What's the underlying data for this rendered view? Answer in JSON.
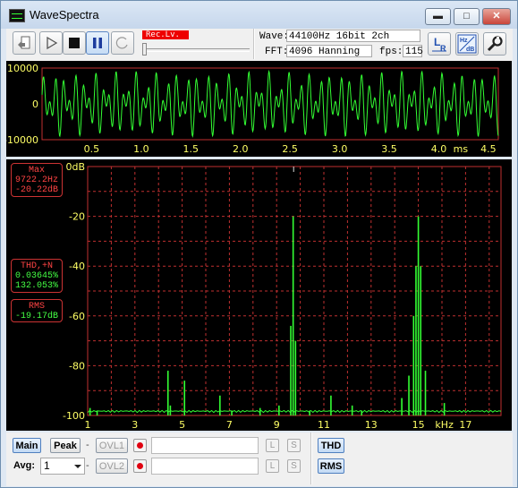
{
  "window": {
    "title": "WaveSpectra",
    "minimize": "▬",
    "maximize": "□",
    "close": "✕"
  },
  "toolbar": {
    "rec_level": "Rec.Lv.",
    "wave_label": "Wave:",
    "wave_value": "44100Hz 16bit 2ch",
    "fft_label": "FFT:",
    "fft_value": "4096 Hanning",
    "fps_label": "fps:",
    "fps_value": "115",
    "icons": [
      "open-file-icon",
      "play-icon",
      "stop-icon",
      "pause-icon",
      "record-icon",
      "lr-channel-icon",
      "hz-db-icon",
      "settings-wrench-icon"
    ]
  },
  "colors": {
    "grid": "#c03030",
    "trace": "#33ff33",
    "label_red": "#ff4444",
    "label_green": "#44ff44",
    "axis_text": "#ffff66"
  },
  "wave": {
    "y_labels": [
      "10000",
      "0",
      "-10000"
    ],
    "x_labels": [
      "0.5",
      "1.0",
      "1.5",
      "2.0",
      "2.5",
      "3.0",
      "3.5",
      "4.0",
      "4.5"
    ],
    "x_unit": "ms"
  },
  "readouts": {
    "max_title": "Max",
    "max_freq": "9722.2Hz",
    "max_db": "-20.22dB",
    "thd_title": "THD,+N",
    "thd_1": "0.03645%",
    "thd_2": "132.053%",
    "rms_title": "RMS",
    "rms_value": "-19.17dB"
  },
  "chart_data": {
    "type": "bar",
    "title": "",
    "xlabel": "kHz",
    "ylabel": "",
    "x_ticks": [
      1,
      3,
      5,
      7,
      9,
      11,
      13,
      15,
      17
    ],
    "y_ticks": [
      "0dB",
      "-20",
      "-40",
      "-60",
      "-80",
      "-100"
    ],
    "xlim": [
      1,
      18.5
    ],
    "ylim": [
      -100,
      0
    ],
    "grid": true,
    "x": [
      1.1,
      1.4,
      4.4,
      4.5,
      5.1,
      6.6,
      7.1,
      8.3,
      9.1,
      9.6,
      9.7,
      9.8,
      10.4,
      11.3,
      12.2,
      12.6,
      14.3,
      14.6,
      14.8,
      14.9,
      15.0,
      15.1,
      15.3,
      16.1
    ],
    "values": [
      -97,
      -98,
      -82,
      -96,
      -86,
      -92,
      -98,
      -97,
      -96,
      -64,
      -20,
      -70,
      -98,
      -92,
      -96,
      -98,
      -93,
      -84,
      -60,
      -40,
      -20,
      -40,
      -82,
      -95
    ]
  },
  "bottom": {
    "main": "Main",
    "peak": "Peak",
    "ovl1": "OVL1",
    "ovl2": "OVL2",
    "dash": "-",
    "avg_label": "Avg:",
    "avg_value": "1",
    "l": "L",
    "s": "S",
    "thd": "THD",
    "rms": "RMS"
  }
}
